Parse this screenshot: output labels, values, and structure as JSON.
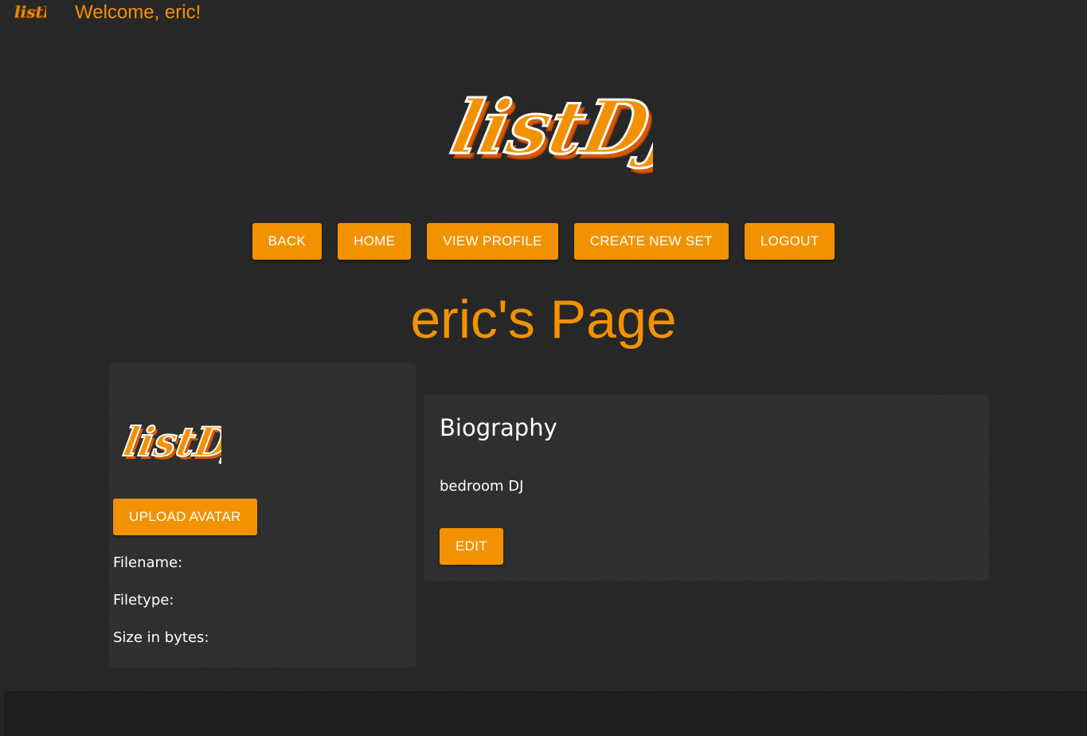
{
  "header": {
    "welcome_text": "Welcome, eric!",
    "logo_text": "listDJ"
  },
  "logo": {
    "text": "listDJ"
  },
  "nav": {
    "back_label": "BACK",
    "home_label": "HOME",
    "view_profile_label": "VIEW PROFILE",
    "create_new_set_label": "CREATE NEW SET",
    "logout_label": "LOGOUT"
  },
  "page": {
    "title": "eric's Page"
  },
  "avatar_panel": {
    "avatar_text": "listDJ",
    "upload_label": "UPLOAD AVATAR",
    "filename_label": "Filename:",
    "filetype_label": "Filetype:",
    "size_label": "Size in bytes:"
  },
  "biography": {
    "title": "Biography",
    "text": "bedroom DJ",
    "edit_label": "EDIT"
  },
  "colors": {
    "accent": "#f39200",
    "background": "#262626",
    "card": "#2e2e2e",
    "text": "#ffffff"
  }
}
